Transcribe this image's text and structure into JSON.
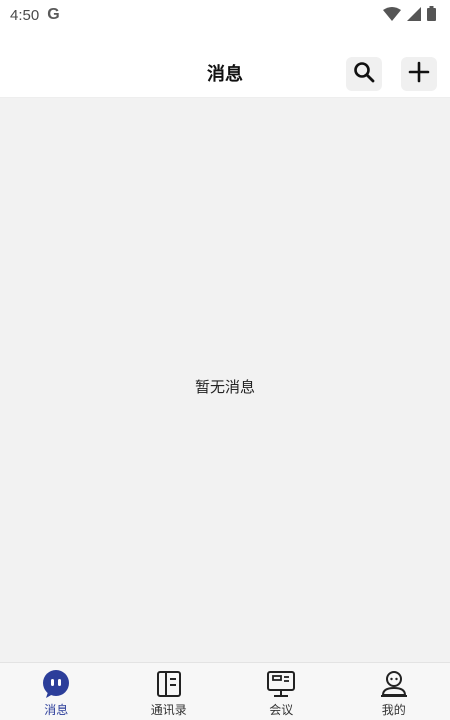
{
  "status_bar": {
    "time": "4:50",
    "carrier_icon_text": "G",
    "icons": [
      "wifi-icon",
      "signal-icon",
      "battery-icon"
    ]
  },
  "header": {
    "title": "消息",
    "actions": [
      "search-icon",
      "plus-icon"
    ]
  },
  "main": {
    "empty_message": "暂无消息"
  },
  "tabbar": {
    "tabs": [
      {
        "label": "消息",
        "icon": "chat-bubble-icon",
        "active": true
      },
      {
        "label": "通讯录",
        "icon": "contacts-book-icon",
        "active": false
      },
      {
        "label": "会议",
        "icon": "monitor-icon",
        "active": false
      },
      {
        "label": "我的",
        "icon": "profile-icon",
        "active": false
      }
    ]
  },
  "colors": {
    "accent": "#2c3e9a",
    "content_background": "#f2f2f2",
    "tabbar_background": "#f7f7f7"
  }
}
